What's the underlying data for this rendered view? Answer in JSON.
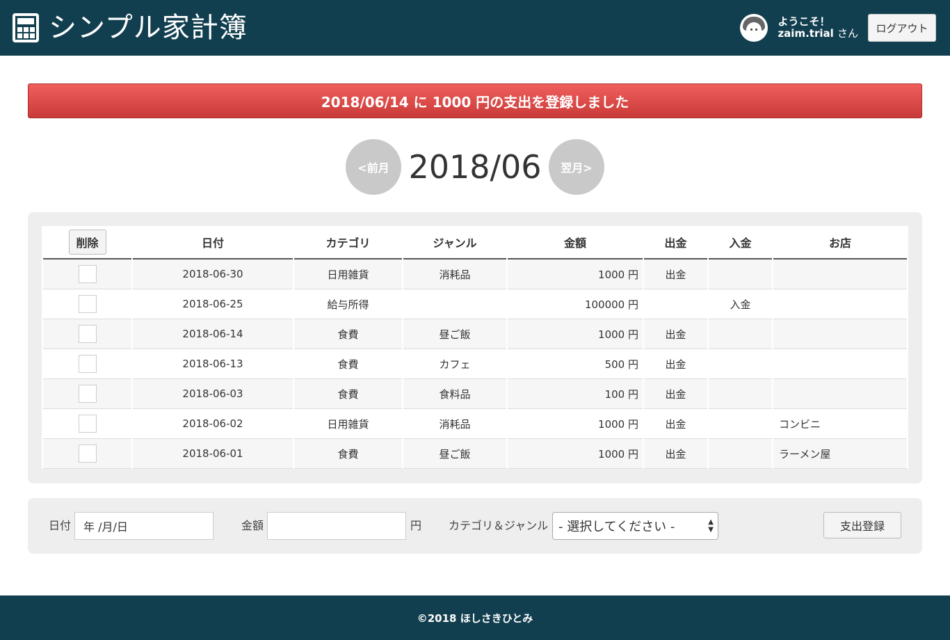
{
  "header": {
    "title": "シンプル家計簿",
    "welcome_line1": "ようこそ！",
    "username": "zaim.trial",
    "san": "さん",
    "logout_label": "ログアウト"
  },
  "flash": {
    "message": "2018/06/14 に 1000 円の支出を登録しました",
    "color": "#e04f4c"
  },
  "month_nav": {
    "prev_label": "<前月",
    "current": "2018/06",
    "next_label": "翌月>"
  },
  "table": {
    "delete_label": "削除",
    "columns": [
      "日付",
      "カテゴリ",
      "ジャンル",
      "金額",
      "出金",
      "入金",
      "お店"
    ],
    "rows": [
      {
        "date": "2018-06-30",
        "category": "日用雑貨",
        "genre": "消耗品",
        "amount": "1000 円",
        "out": "出金",
        "in": "",
        "shop": ""
      },
      {
        "date": "2018-06-25",
        "category": "給与所得",
        "genre": "",
        "amount": "100000 円",
        "out": "",
        "in": "入金",
        "shop": ""
      },
      {
        "date": "2018-06-14",
        "category": "食費",
        "genre": "昼ご飯",
        "amount": "1000 円",
        "out": "出金",
        "in": "",
        "shop": ""
      },
      {
        "date": "2018-06-13",
        "category": "食費",
        "genre": "カフェ",
        "amount": "500 円",
        "out": "出金",
        "in": "",
        "shop": ""
      },
      {
        "date": "2018-06-03",
        "category": "食費",
        "genre": "食料品",
        "amount": "100 円",
        "out": "出金",
        "in": "",
        "shop": ""
      },
      {
        "date": "2018-06-02",
        "category": "日用雑貨",
        "genre": "消耗品",
        "amount": "1000 円",
        "out": "出金",
        "in": "",
        "shop": "コンビニ"
      },
      {
        "date": "2018-06-01",
        "category": "食費",
        "genre": "昼ご飯",
        "amount": "1000 円",
        "out": "出金",
        "in": "",
        "shop": "ラーメン屋"
      }
    ]
  },
  "form": {
    "date_label": "日付",
    "date_value": "年 /月/日",
    "amount_label": "金額",
    "amount_value": "",
    "yen": "円",
    "category_label": "カテゴリ＆ジャンル",
    "category_selected": "- 選択してください -",
    "submit_label": "支出登録"
  },
  "footer": {
    "copyright": "©2018 ほしさきひとみ"
  },
  "colors": {
    "header_bg": "#123f4f",
    "panel_bg": "#eeeeee",
    "nav_btn_bg": "#c9c9c9"
  }
}
